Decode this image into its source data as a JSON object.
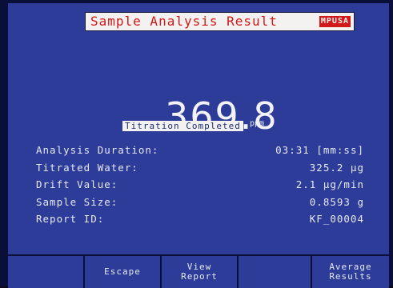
{
  "header": {
    "title": "Sample Analysis Result",
    "badge": "MPUSA"
  },
  "result": {
    "value": "369.8",
    "unit": "ppm",
    "status": "Titration Completed"
  },
  "details": [
    {
      "label": "Analysis Duration:",
      "value": "03:31 [mm:ss]"
    },
    {
      "label": "Titrated Water:",
      "value": "325.2 µg"
    },
    {
      "label": "Drift Value:",
      "value": "2.1 µg/min"
    },
    {
      "label": "Sample Size:",
      "value": "0.8593 g"
    },
    {
      "label": "Report ID:",
      "value": "KF_00004"
    }
  ],
  "softkeys": {
    "escape": "Escape",
    "view_report_line1": "View",
    "view_report_line2": "Report",
    "average_results_line1": "Average",
    "average_results_line2": "Results"
  },
  "colors": {
    "screen_background": "#2c3c98",
    "title_text": "#d11717",
    "bezel": "#0a0f3a"
  }
}
